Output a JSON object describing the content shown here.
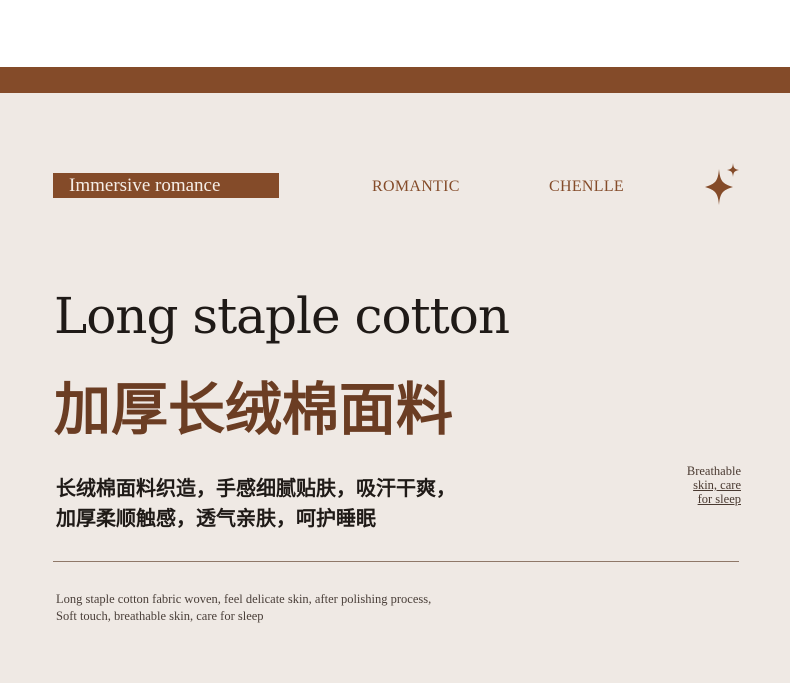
{
  "header": {
    "tag_label": "Immersive romance",
    "nav_items": [
      "ROMANTIC",
      "CHENLLE"
    ],
    "icon": "sparkle-star-icon"
  },
  "hero": {
    "title_en": "Long staple cotton",
    "title_cn": "加厚长绒棉面料"
  },
  "description": {
    "line1": "长绒棉面料织造，手感细腻贴肤，吸汗干爽，",
    "line2": "加厚柔顺触感，透气亲肤，呵护睡眠"
  },
  "side_note": {
    "line1": "Breathable",
    "line2": "skin, care",
    "line3": "for sleep"
  },
  "caption": {
    "line1": "Long staple cotton fabric woven, feel delicate skin, after polishing process,",
    "line2": "Soft touch, breathable skin, care for sleep"
  },
  "colors": {
    "brand_brown": "#844b29",
    "heading_brown": "#6b3d23",
    "panel_background": "#efe9e4"
  }
}
